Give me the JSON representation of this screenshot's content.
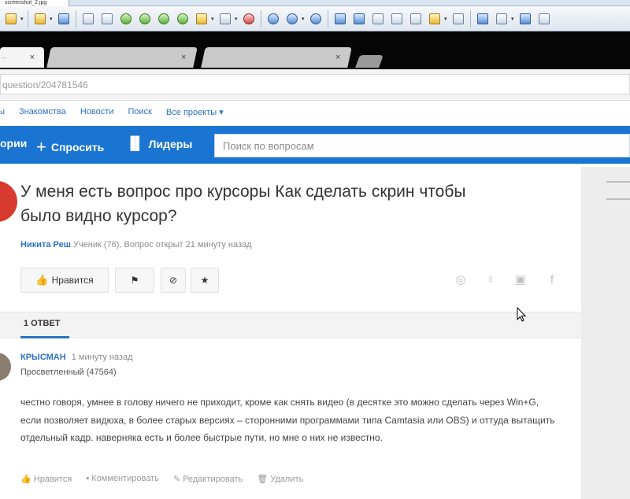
{
  "viewer": {
    "tab_label": "screenshot_2.jpg"
  },
  "browser": {
    "tab_active_label": "...",
    "tab_close": "×",
    "address": "question/204781546"
  },
  "topnav": [
    "ры",
    "Знакомства",
    "Новости",
    "Поиск",
    "Все проекты ▾"
  ],
  "bluebar": {
    "item1": "ории",
    "ask_label": "Спросить",
    "leaders_label": "Лидеры",
    "search_placeholder": "Поиск по вопросам"
  },
  "question": {
    "title": "У меня есть вопрос про курсоры Как сделать скрин чтобы было видно курсор?",
    "author": "Никита Реш",
    "meta": "Ученик (76), Вопрос открыт 21 минуту назад",
    "like_label": "Нравится"
  },
  "answers": {
    "tab_label": "1 ОТВЕТ",
    "author": "КРЫСМАН",
    "time": "1 минуту назад",
    "rank": "Просветленный (47564)",
    "text": "честно говоря, умнее в голову ничего не приходит, кроме как снять видео (в десятке это можно сделать через Win+G, если позволяет видюха, в более старых версиях – сторонними программами типа Camtasia или OBS) и оттуда вытащить отдельный кадр. наверняка есть и более быстрые пути, но мне о них не известно.",
    "actions": {
      "like": "Нравится",
      "comment": "Комментировать",
      "edit": "Редактировать",
      "delete": "Удалить"
    }
  }
}
